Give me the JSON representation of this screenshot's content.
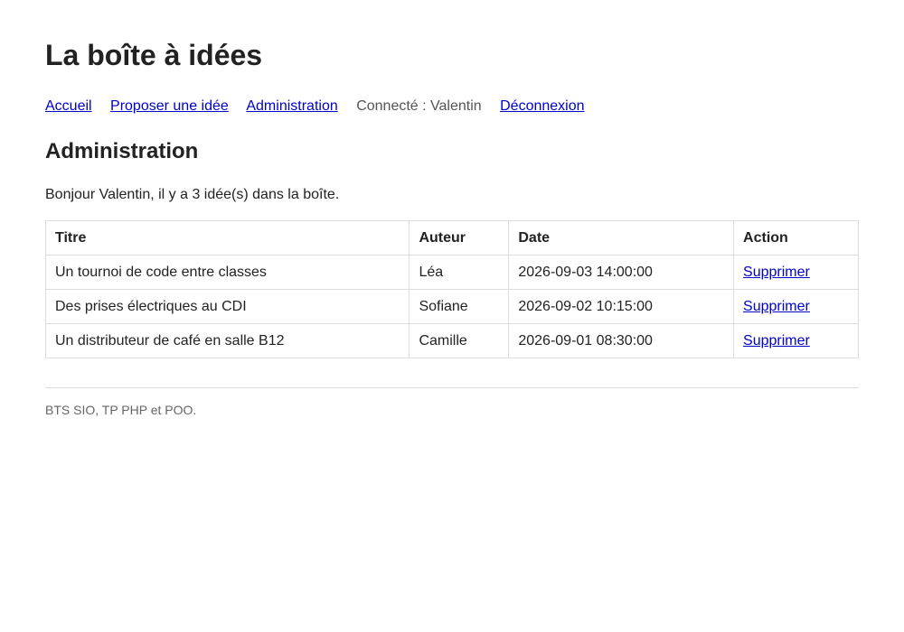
{
  "header": {
    "title": "La boîte à idées"
  },
  "nav": {
    "home": "Accueil",
    "propose": "Proposer une idée",
    "admin": "Administration",
    "status": "Connecté : Valentin",
    "logout": "Déconnexion"
  },
  "main": {
    "heading": "Administration",
    "intro": "Bonjour Valentin, il y a 3 idée(s) dans la boîte.",
    "table": {
      "headers": [
        "Titre",
        "Auteur",
        "Date",
        "Action"
      ],
      "rows": [
        {
          "title": "Un tournoi de code entre classes",
          "author": "Léa",
          "date": "2026-09-03 14:00:00",
          "action": "Supprimer"
        },
        {
          "title": "Des prises électriques au CDI",
          "author": "Sofiane",
          "date": "2026-09-02 10:15:00",
          "action": "Supprimer"
        },
        {
          "title": "Un distributeur de café en salle B12",
          "author": "Camille",
          "date": "2026-09-01 08:30:00",
          "action": "Supprimer"
        }
      ]
    }
  },
  "footer": {
    "text": "BTS SIO, TP PHP et POO."
  },
  "colors": {
    "link": "#0000cc",
    "text": "#222222",
    "border": "#dddddd",
    "muted": "#666666"
  }
}
